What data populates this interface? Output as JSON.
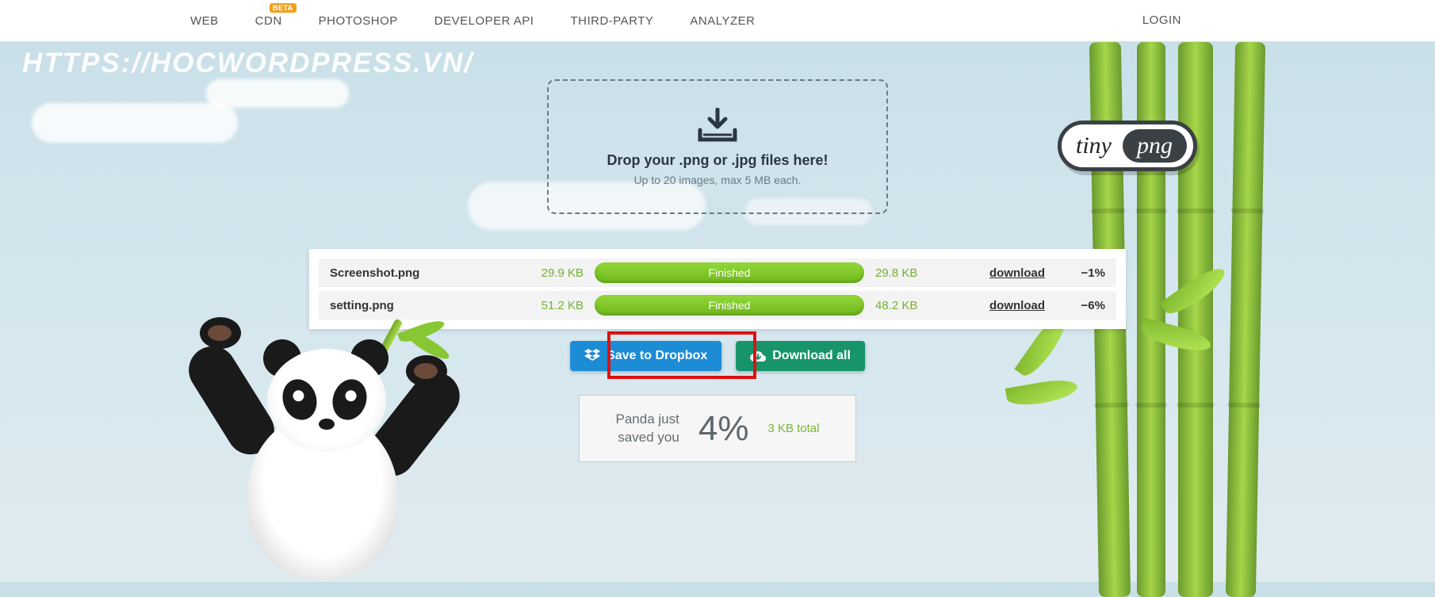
{
  "nav": {
    "items": [
      "WEB",
      "CDN",
      "PHOTOSHOP",
      "DEVELOPER API",
      "THIRD-PARTY",
      "ANALYZER"
    ],
    "beta_badge": "BETA",
    "login": "LOGIN"
  },
  "watermark": "HTTPS://HOCWORDPRESS.VN/",
  "logo": {
    "left": "tiny",
    "right": "png"
  },
  "dropzone": {
    "title": "Drop your .png or .jpg files here!",
    "subtitle": "Up to 20 images, max 5 MB each."
  },
  "results": [
    {
      "name": "Screenshot.png",
      "in": "29.9 KB",
      "status": "Finished",
      "out": "29.8 KB",
      "link": "download",
      "pct": "−1%"
    },
    {
      "name": "setting.png",
      "in": "51.2 KB",
      "status": "Finished",
      "out": "48.2 KB",
      "link": "download",
      "pct": "−6%"
    }
  ],
  "actions": {
    "dropbox": "Save to Dropbox",
    "download_all": "Download all"
  },
  "savings": {
    "text_line1": "Panda just",
    "text_line2": "saved you",
    "pct": "4%",
    "total": "3 KB total"
  }
}
